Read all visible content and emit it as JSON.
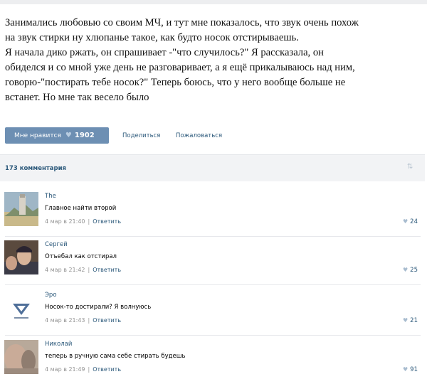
{
  "post": {
    "lines": [
      "Занимались любовью со своим МЧ, и тут мне показалось, что звук очень похож",
      "на звук стирки ну хлюпанье такое, как будто носок отстирываешь.",
      "Я начала дико ржать, он спрашивает -\"что случилось?\" Я рассказала, он",
      "обиделся и со мной уже день не разговаривает, а я ещё прикалываюсь над ним,",
      "говорю-\"постирать тебе носок?\" Теперь боюсь, что у него вообще больше не",
      "встанет. Но мне так весело было"
    ]
  },
  "actions": {
    "like_label": "Мне нравится",
    "like_count": "1902",
    "share_label": "Поделиться",
    "report_label": "Пожаловаться"
  },
  "comments_header": {
    "count_label": "173 комментария"
  },
  "comments": [
    {
      "author": "The",
      "text": "Главное найти второй",
      "date": "4 мар в 21:40",
      "reply": "Ответить",
      "likes": "24"
    },
    {
      "author": "Сергей",
      "text": "Отъебал как отстирал",
      "date": "4 мар в 21:42",
      "reply": "Ответить",
      "likes": "25"
    },
    {
      "author": "Эро",
      "text": "Носок-то достирали? Я волнуюсь",
      "date": "4 мар в 21:43",
      "reply": "Ответить",
      "likes": "21"
    },
    {
      "author": "Николай",
      "text": "теперь в ручную сама себе стирать будешь",
      "date": "4 мар в 21:49",
      "reply": "Ответить",
      "likes": "91"
    }
  ],
  "colors": {
    "link": "#2b587a",
    "like_button": "#6d8fb3",
    "header_bg": "#f2f3f5"
  }
}
